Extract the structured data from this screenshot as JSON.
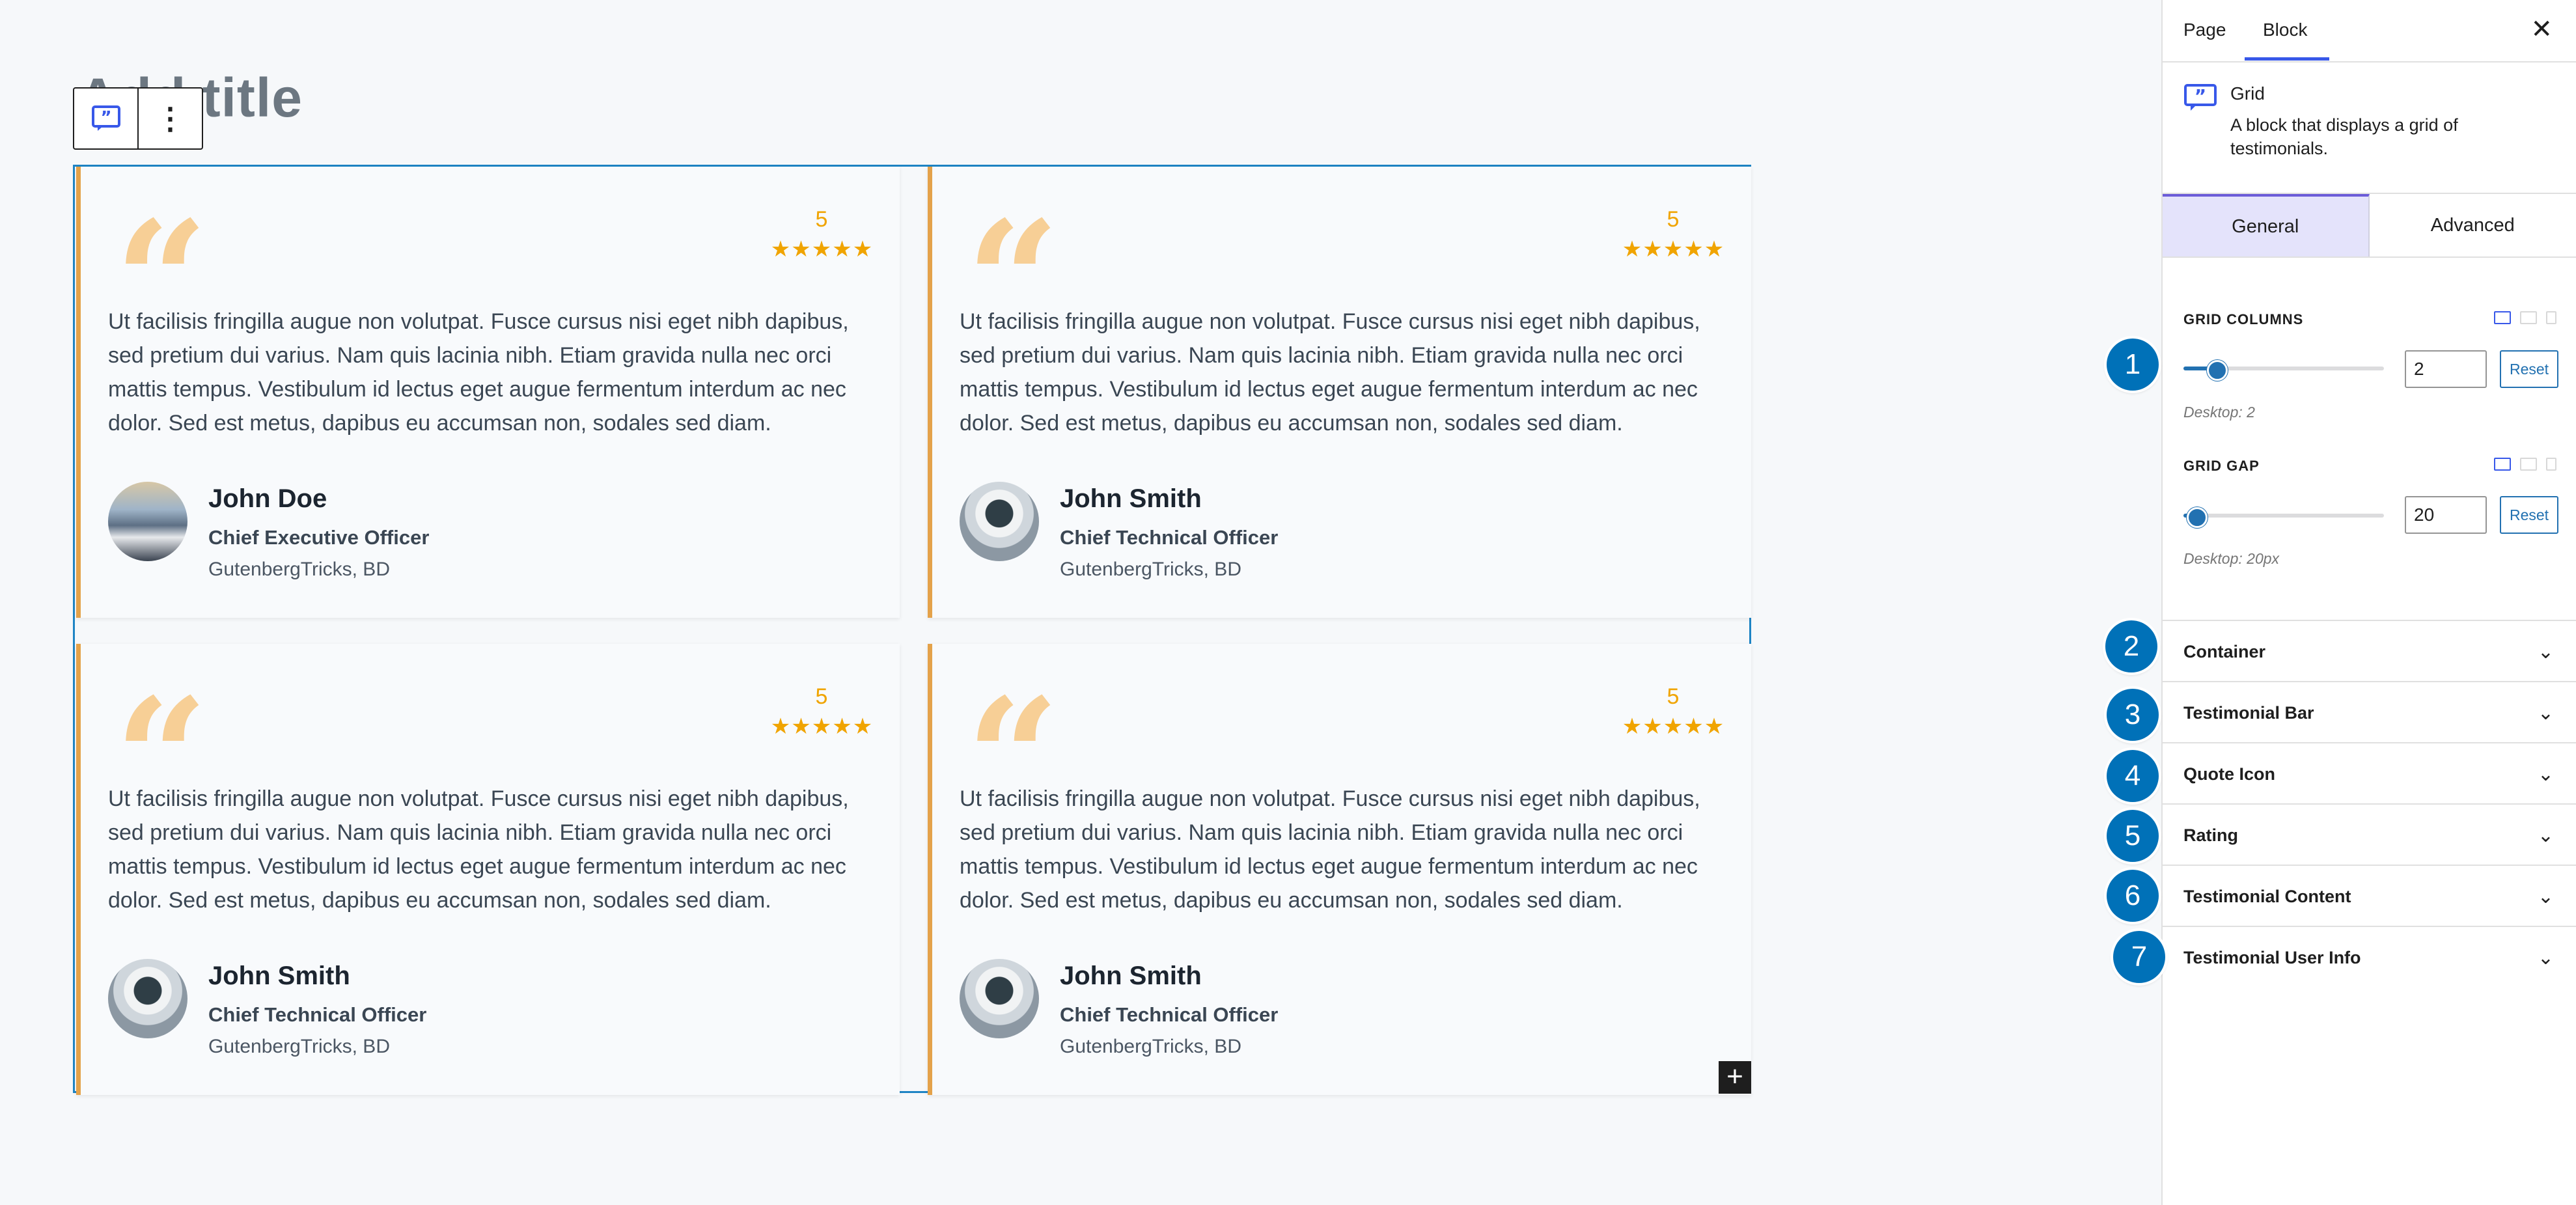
{
  "page": {
    "title": "Add title"
  },
  "toolbar": {
    "block_icon": "quote-icon",
    "more_icon": "⋮"
  },
  "cards": [
    {
      "rating": "5",
      "text": "Ut facilisis fringilla augue non volutpat. Fusce cursus nisi eget nibh dapibus, sed pretium dui varius. Nam quis lacinia nibh. Etiam gravida nulla nec orci mattis tempus. Vestibulum id lectus eget augue fermentum interdum ac nec dolor. Sed est metus, dapibus eu accumsan non, sodales sed diam.",
      "name": "John Doe",
      "role": "Chief Executive Officer",
      "company": "GutenbergTricks, BD"
    },
    {
      "rating": "5",
      "text": "Ut facilisis fringilla augue non volutpat. Fusce cursus nisi eget nibh dapibus, sed pretium dui varius. Nam quis lacinia nibh. Etiam gravida nulla nec orci mattis tempus. Vestibulum id lectus eget augue fermentum interdum ac nec dolor. Sed est metus, dapibus eu accumsan non, sodales sed diam.",
      "name": "John Smith",
      "role": "Chief Technical Officer",
      "company": "GutenbergTricks, BD"
    },
    {
      "rating": "5",
      "text": "Ut facilisis fringilla augue non volutpat. Fusce cursus nisi eget nibh dapibus, sed pretium dui varius. Nam quis lacinia nibh. Etiam gravida nulla nec orci mattis tempus. Vestibulum id lectus eget augue fermentum interdum ac nec dolor. Sed est metus, dapibus eu accumsan non, sodales sed diam.",
      "name": "John Smith",
      "role": "Chief Technical Officer",
      "company": "GutenbergTricks, BD"
    },
    {
      "rating": "5",
      "text": "Ut facilisis fringilla augue non volutpat. Fusce cursus nisi eget nibh dapibus, sed pretium dui varius. Nam quis lacinia nibh. Etiam gravida nulla nec orci mattis tempus. Vestibulum id lectus eget augue fermentum interdum ac nec dolor. Sed est metus, dapibus eu accumsan non, sodales sed diam.",
      "name": "John Smith",
      "role": "Chief Technical Officer",
      "company": "GutenbergTricks, BD"
    }
  ],
  "sidebar": {
    "tabs": {
      "page": "Page",
      "block": "Block"
    },
    "close": "✕",
    "block": {
      "title": "Grid",
      "description": "A block that displays a grid of testimonials."
    },
    "settings_tabs": {
      "general": "General",
      "advanced": "Advanced"
    },
    "grid_columns": {
      "label": "GRID COLUMNS",
      "value": "2",
      "reset": "Reset",
      "help": "Desktop: 2",
      "slider_fraction": 0.16
    },
    "grid_gap": {
      "label": "GRID GAP",
      "value": "20",
      "reset": "Reset",
      "help": "Desktop: 20px",
      "slider_fraction": 0.06
    },
    "panels": [
      "Container",
      "Testimonial Bar",
      "Quote Icon",
      "Rating",
      "Testimonial Content",
      "Testimonial User Info"
    ]
  },
  "badges": [
    "1",
    "2",
    "3",
    "4",
    "5",
    "6",
    "7"
  ],
  "colors": {
    "accent": "#f0a400",
    "bar": "#e4a24a",
    "selection": "#1e84c4",
    "badge": "#0071b8",
    "wp_blue": "#2271b1"
  }
}
